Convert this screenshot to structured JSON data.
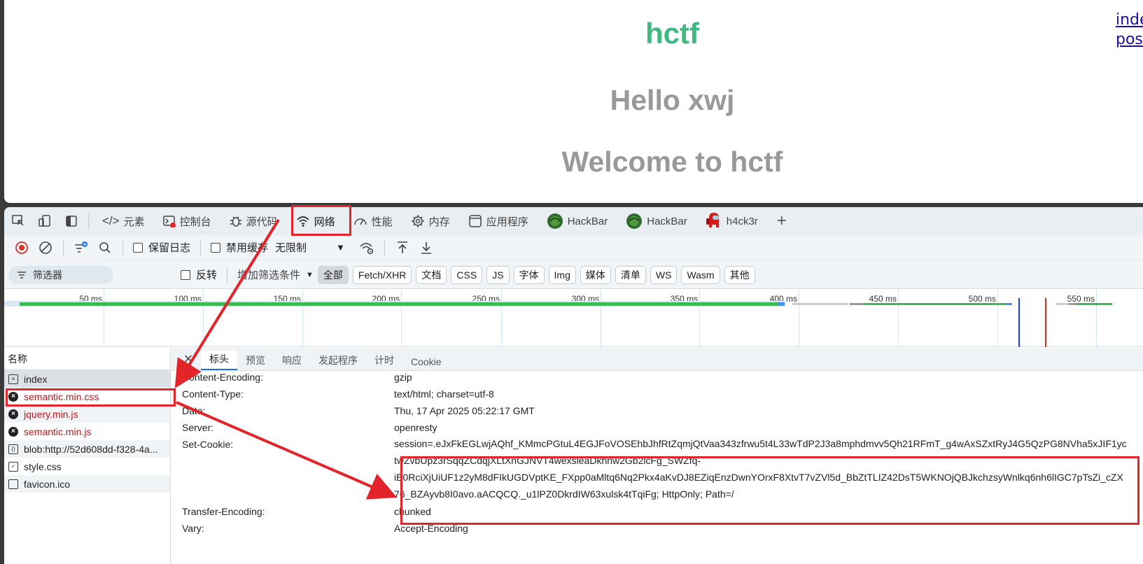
{
  "page": {
    "title": "hctf",
    "hello": "Hello xwj",
    "welcome": "Welcome to hctf",
    "links": [
      "inde",
      "post"
    ]
  },
  "devtools": {
    "tabs": [
      {
        "label": "元素",
        "icon": "code-icon"
      },
      {
        "label": "控制台",
        "icon": "console-icon"
      },
      {
        "label": "源代码",
        "icon": "bug-icon"
      },
      {
        "label": "网络",
        "icon": "wifi-icon"
      },
      {
        "label": "性能",
        "icon": "gauge-icon"
      },
      {
        "label": "内存",
        "icon": "chip-icon"
      },
      {
        "label": "应用程序",
        "icon": "window-icon"
      },
      {
        "label": "HackBar",
        "icon": "hackbar-logo-icon"
      },
      {
        "label": "HackBar",
        "icon": "hackbar-logo-icon"
      },
      {
        "label": "h4ck3r",
        "icon": "amongus-icon"
      }
    ],
    "toolbar": {
      "preserve_log": "保留日志",
      "disable_cache": "禁用缓存",
      "throttle": "无限制"
    },
    "filter": {
      "placeholder": "筛选器",
      "invert": "反转",
      "more_filters": "增加筛选条件",
      "types": [
        "全部",
        "Fetch/XHR",
        "文档",
        "CSS",
        "JS",
        "字体",
        "Img",
        "媒体",
        "清单",
        "WS",
        "Wasm",
        "其他"
      ]
    },
    "timeline_ticks": [
      "50 ms",
      "100 ms",
      "150 ms",
      "200 ms",
      "250 ms",
      "300 ms",
      "350 ms",
      "400 ms",
      "450 ms",
      "500 ms",
      "550 ms"
    ],
    "requests": {
      "header": "名称",
      "items": [
        {
          "name": "index",
          "status": "doc"
        },
        {
          "name": "semantic.min.css",
          "status": "error"
        },
        {
          "name": "jquery.min.js",
          "status": "error"
        },
        {
          "name": "semantic.min.js",
          "status": "error"
        },
        {
          "name": "blob:http://52d608dd-f328-4a...",
          "status": "blob"
        },
        {
          "name": "style.css",
          "status": "css"
        },
        {
          "name": "favicon.ico",
          "status": "empty"
        }
      ]
    },
    "detail": {
      "tabs": [
        "标头",
        "预览",
        "响应",
        "发起程序",
        "计时",
        "Cookie"
      ],
      "headers": [
        {
          "name": "Content-Encoding:",
          "value": "gzip"
        },
        {
          "name": "Content-Type:",
          "value": "text/html; charset=utf-8"
        },
        {
          "name": "Date:",
          "value": "Thu, 17 Apr 2025 05:22:17 GMT"
        },
        {
          "name": "Server:",
          "value": "openresty"
        },
        {
          "name": "Set-Cookie:",
          "value": ""
        },
        {
          "name": "Transfer-Encoding:",
          "value": "chunked"
        },
        {
          "name": "Vary:",
          "value": "Accept-Encoding"
        }
      ],
      "cookie_lines": [
        "session=.eJxFkEGLwjAQhf_KMmcPGtuL4EGJFoVOSEhbJhfRtZqmjQtVaa343zfrwu5t4L33wTdP2J3a8mphdmvv5Qh21RFmT_g4wAxSZxtRyJ4G5QzPG8NVha5xJIF1yc",
        "twZvbUpz3rSqqZCdqjXLtXnGJNVT4wexsleaDkhnw2Gb2lcFg_SWZfq-",
        "iE0RciXjUiUF1z2yM8dFIkUGDVptKE_FXpp0aMltq6Nq2Pkx4aKvDJ8EZiqEnzDwnYOrxF8XtvT7vZVl5d_BbZtTLIZ42DsT5WKNOjQBJkchzsyWnlkq6nh6lIGC7pTsZi_cZX",
        "76_BZAyvb8I0avo.aACQCQ._u1lPZ0DkrdIW63xulsk4tTqiFg; HttpOnly; Path=/"
      ]
    }
  },
  "colors": {
    "title_green": "#42b983",
    "annotation_red": "#e3242b",
    "error_red": "#c4151c"
  }
}
